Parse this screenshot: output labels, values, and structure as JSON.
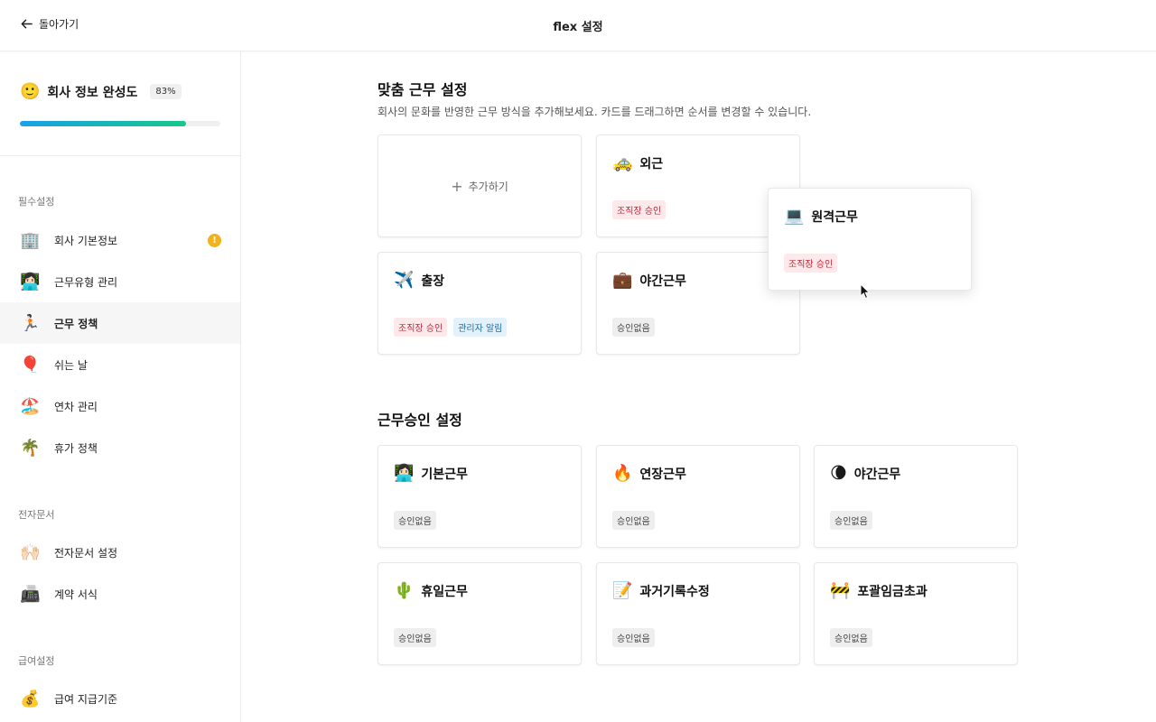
{
  "topbar": {
    "back_label": "돌아가기",
    "title": "flex 설정"
  },
  "sidebar": {
    "progress": {
      "emoji": "🙂",
      "title": "회사 정보 완성도",
      "percent_label": "83%",
      "value": 0.83
    },
    "sections": [
      {
        "label": "필수설정"
      },
      {
        "label": "전자문서"
      },
      {
        "label": "급여설정"
      }
    ],
    "items": [
      {
        "emoji": "🏢",
        "label": "회사 기본정보",
        "warning": "!"
      },
      {
        "emoji": "👩🏻‍💻",
        "label": "근무유형 관리"
      },
      {
        "emoji": "🏃🏻",
        "label": "근무 정책"
      },
      {
        "emoji": "🎈",
        "label": "쉬는 날"
      },
      {
        "emoji": "🏖️",
        "label": "연차 관리"
      },
      {
        "emoji": "🌴",
        "label": "휴가 정책"
      },
      {
        "emoji": "🙌🏻",
        "label": "전자문서 설정"
      },
      {
        "emoji": "📠",
        "label": "계약 서식"
      },
      {
        "emoji": "💰",
        "label": "급여 지급기준"
      }
    ]
  },
  "custom": {
    "title": "맞춤 근무 설정",
    "desc": "회사의 문화를 반영한 근무 방식을 추가해보세요. 카드를 드래그하면 순서를 변경할 수 있습니다.",
    "add_label": "추가하기",
    "add_icon": "+",
    "cards": [
      {
        "emoji": "🚕",
        "name": "외근",
        "tags": [
          {
            "text": "조직장 승인",
            "color": "red"
          }
        ]
      },
      {
        "emoji": "✈️",
        "name": "출장",
        "tags": [
          {
            "text": "조직장 승인",
            "color": "red"
          },
          {
            "text": "관리자 알림",
            "color": "blue"
          }
        ]
      },
      {
        "emoji": "💼",
        "name": "야간근무",
        "tags": [
          {
            "text": "승인없음",
            "color": "gray"
          }
        ]
      },
      {
        "emoji": "💻",
        "name": "원격근무",
        "tags": [
          {
            "text": "조직장 승인",
            "color": "red"
          }
        ]
      }
    ]
  },
  "approval": {
    "title": "근무승인 설정",
    "cards": [
      {
        "emoji": "👩🏻‍💻",
        "name": "기본근무",
        "tag": "승인없음"
      },
      {
        "emoji": "🔥",
        "name": "연장근무",
        "tag": "승인없음"
      },
      {
        "emoji": "🌘",
        "name": "야간근무",
        "tag": "승인없음"
      },
      {
        "emoji": "🌵",
        "name": "휴일근무",
        "tag": "승인없음"
      },
      {
        "emoji": "📝",
        "name": "과거기록수정",
        "tag": "승인없음"
      },
      {
        "emoji": "🚧",
        "name": "포괄임금초과",
        "tag": "승인없음"
      }
    ]
  }
}
